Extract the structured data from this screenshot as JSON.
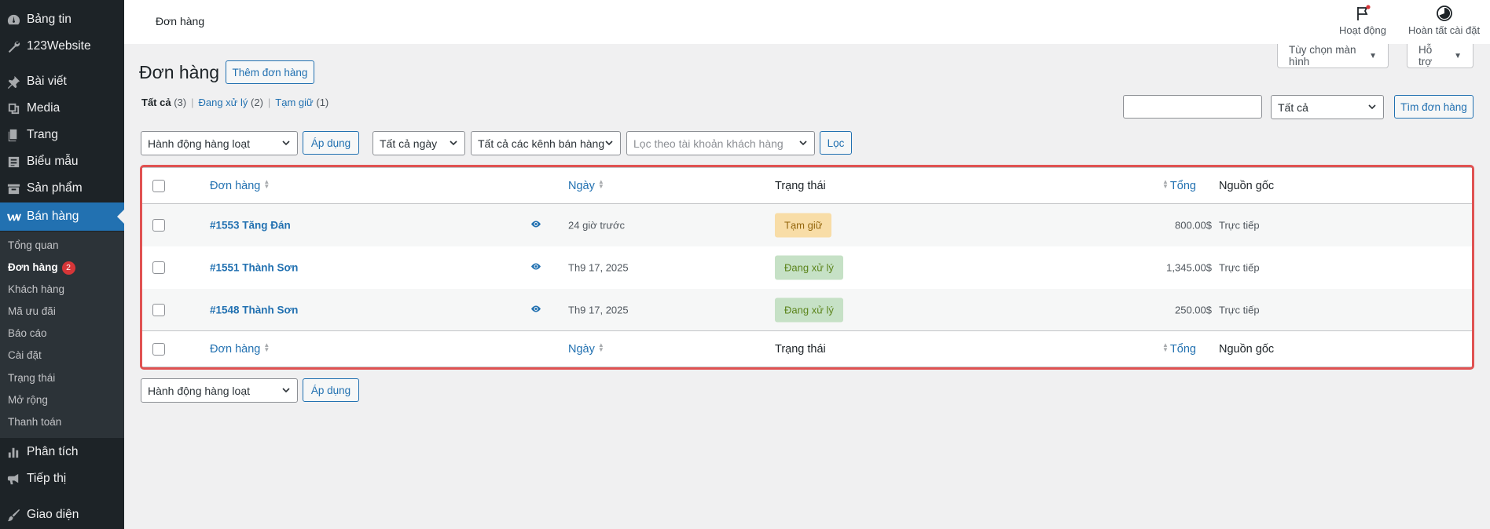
{
  "sidebar": {
    "items": [
      {
        "label": "Bảng tin",
        "icon": "dashboard-icon"
      },
      {
        "label": "123Website",
        "icon": "wrench-icon"
      },
      {
        "label": "Bài viết",
        "icon": "pin-icon"
      },
      {
        "label": "Media",
        "icon": "media-icon"
      },
      {
        "label": "Trang",
        "icon": "pages-icon"
      },
      {
        "label": "Biểu mẫu",
        "icon": "forms-icon"
      },
      {
        "label": "Sản phẩm",
        "icon": "archive-icon"
      },
      {
        "label": "Bán hàng",
        "icon": "woocommerce-icon"
      },
      {
        "label": "Phân tích",
        "icon": "bar-chart-icon"
      },
      {
        "label": "Tiếp thị",
        "icon": "megaphone-icon"
      },
      {
        "label": "Giao diện",
        "icon": "brush-icon"
      }
    ],
    "submenu": [
      {
        "label": "Tổng quan"
      },
      {
        "label": "Đơn hàng",
        "badge": "2"
      },
      {
        "label": "Khách hàng"
      },
      {
        "label": "Mã ưu đãi"
      },
      {
        "label": "Báo cáo"
      },
      {
        "label": "Cài đặt"
      },
      {
        "label": "Trạng thái"
      },
      {
        "label": "Mở rộng"
      },
      {
        "label": "Thanh toán"
      }
    ]
  },
  "header": {
    "page_label": "Đơn hàng",
    "activity_label": "Hoạt động",
    "setup_label": "Hoàn tất cài đặt",
    "screen_options": "Tùy chọn màn hình",
    "help": "Hỗ trợ"
  },
  "main": {
    "title": "Đơn hàng",
    "add_order": "Thêm đơn hàng",
    "views": [
      {
        "label": "Tất cả",
        "count": "(3)"
      },
      {
        "label": "Đang xử lý",
        "count": "(2)"
      },
      {
        "label": "Tạm giữ",
        "count": "(1)"
      }
    ],
    "search": {
      "value": "",
      "status_select": "Tất cả",
      "button": "Tìm đơn hàng"
    },
    "bulk_action": "Hành động hàng loạt",
    "apply": "Áp dụng",
    "date_filter": "Tất cả ngày",
    "channel_filter": "Tất cả các kênh bán hàng",
    "customer_filter_placeholder": "Lọc theo tài khoản khách hàng",
    "filter_button": "Lọc"
  },
  "table": {
    "columns": {
      "order": "Đơn hàng",
      "date": "Ngày",
      "status": "Trạng thái",
      "total": "Tổng",
      "origin": "Nguồn gốc"
    },
    "rows": [
      {
        "order": "#1553 Tăng Đán",
        "date": "24 giờ trước",
        "status": "Tạm giữ",
        "status_type": "on-hold",
        "total": "800.00$",
        "origin": "Trực tiếp"
      },
      {
        "order": "#1551 Thành Sơn",
        "date": "Th9 17, 2025",
        "status": "Đang xử lý",
        "status_type": "processing",
        "total": "1,345.00$",
        "origin": "Trực tiếp"
      },
      {
        "order": "#1548 Thành Sơn",
        "date": "Th9 17, 2025",
        "status": "Đang xử lý",
        "status_type": "processing",
        "total": "250.00$",
        "origin": "Trực tiếp"
      }
    ]
  },
  "colors": {
    "accent": "#2271b1",
    "sidebar": "#1d2327",
    "highlight": "#e05252",
    "on_hold_bg": "#f8dda7",
    "processing_bg": "#c6e1c6"
  }
}
